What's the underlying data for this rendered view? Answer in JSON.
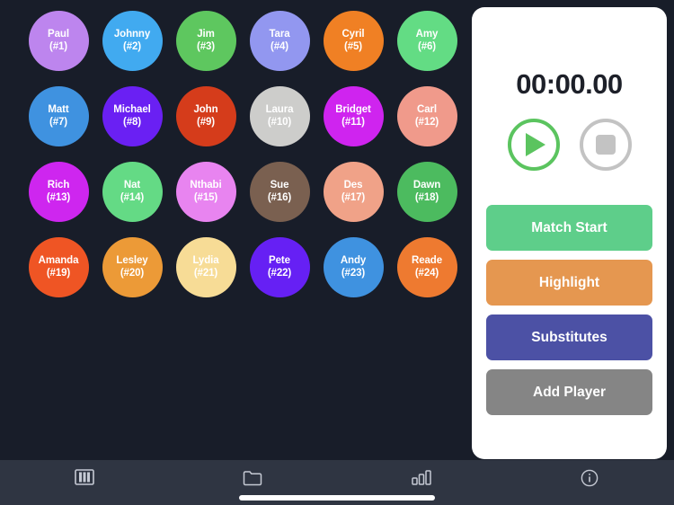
{
  "app": {
    "background_color": "#181d29",
    "tabbar_color": "#2f3542"
  },
  "player_grid": {
    "columns": 6,
    "rows": 4,
    "players": [
      {
        "name": "Paul",
        "number": "(#1)",
        "color": "#bd85ee"
      },
      {
        "name": "Johnny",
        "number": "(#2)",
        "color": "#41aaf0"
      },
      {
        "name": "Jim",
        "number": "(#3)",
        "color": "#5ec75f"
      },
      {
        "name": "Tara",
        "number": "(#4)",
        "color": "#9297f0"
      },
      {
        "name": "Cyril",
        "number": "(#5)",
        "color": "#f08024"
      },
      {
        "name": "Amy",
        "number": "(#6)",
        "color": "#63dc84"
      },
      {
        "name": "Matt",
        "number": "(#7)",
        "color": "#3f92e0"
      },
      {
        "name": "Michael",
        "number": "(#8)",
        "color": "#6a20f3"
      },
      {
        "name": "John",
        "number": "(#9)",
        "color": "#d53c1b"
      },
      {
        "name": "Laura",
        "number": "(#10)",
        "color": "#cdcdcb"
      },
      {
        "name": "Bridget",
        "number": "(#11)",
        "color": "#cf24ef"
      },
      {
        "name": "Carl",
        "number": "(#12)",
        "color": "#f09a8b"
      },
      {
        "name": "Rich",
        "number": "(#13)",
        "color": "#ce26ef"
      },
      {
        "name": "Nat",
        "number": "(#14)",
        "color": "#64da85"
      },
      {
        "name": "Nthabi",
        "number": "(#15)",
        "color": "#e884f0"
      },
      {
        "name": "Sue",
        "number": "(#16)",
        "color": "#7a6050"
      },
      {
        "name": "Des",
        "number": "(#17)",
        "color": "#f0a288"
      },
      {
        "name": "Dawn",
        "number": "(#18)",
        "color": "#4cbb5f"
      },
      {
        "name": "Amanda",
        "number": "(#19)",
        "color": "#ef5524"
      },
      {
        "name": "Lesley",
        "number": "(#20)",
        "color": "#ec9a37"
      },
      {
        "name": "Lydia",
        "number": "(#21)",
        "color": "#f7dc96"
      },
      {
        "name": "Pete",
        "number": "(#22)",
        "color": "#6620f4"
      },
      {
        "name": "Andy",
        "number": "(#23)",
        "color": "#3f92e0"
      },
      {
        "name": "Reade",
        "number": "(#24)",
        "color": "#ee7a30"
      }
    ]
  },
  "control_panel": {
    "timer": "00:00.00",
    "transport": [
      {
        "icon": "play-icon",
        "color": "#5bc45f"
      },
      {
        "icon": "stop-icon",
        "color": "#c3c3c3"
      }
    ],
    "actions": [
      {
        "label": "Match Start",
        "color": "#5ece8a"
      },
      {
        "label": "Highlight",
        "color": "#e59750"
      },
      {
        "label": "Substitutes",
        "color": "#4c51a5"
      },
      {
        "label": "Add Player",
        "color": "#858585"
      }
    ]
  },
  "tab_bar": {
    "items": [
      {
        "icon": "pitch-icon"
      },
      {
        "icon": "folder-icon"
      },
      {
        "icon": "bar-chart-icon"
      },
      {
        "icon": "info-icon"
      }
    ]
  }
}
